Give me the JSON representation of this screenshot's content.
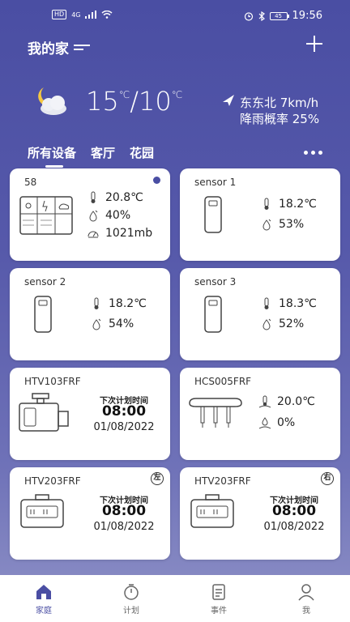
{
  "status_bar": {
    "left_box": "HD",
    "network": "4G",
    "battery": "45",
    "time": "19:56"
  },
  "header": {
    "title": "我的家"
  },
  "weather": {
    "temp_high": "15",
    "temp_low": "10",
    "unit": "℃",
    "separator": "/",
    "wind": "东东北 7km/h",
    "rain": "降雨概率 25%"
  },
  "tabs": [
    {
      "label": "所有设备",
      "active": true
    },
    {
      "label": "客厅",
      "active": false
    },
    {
      "label": "花园",
      "active": false
    }
  ],
  "devices": [
    {
      "name": "58",
      "temp": "20.8℃",
      "humidity": "40%",
      "pressure": "1021mb"
    },
    {
      "name": "sensor 1",
      "temp": "18.2℃",
      "humidity": "53%"
    },
    {
      "name": "sensor 2",
      "temp": "18.2℃",
      "humidity": "54%"
    },
    {
      "name": "sensor 3",
      "temp": "18.3℃",
      "humidity": "52%"
    },
    {
      "name": "HTV103FRF",
      "schedule_label": "下次计划时间",
      "time": "08:00",
      "date": "01/08/2022"
    },
    {
      "name": "HCS005FRF",
      "temp": "20.0℃",
      "humidity": "0%"
    },
    {
      "name": "HTV203FRF",
      "badge": "左",
      "schedule_label": "下次计划时间",
      "time": "08:00",
      "date": "01/08/2022"
    },
    {
      "name": "HTV203FRF",
      "badge": "右",
      "schedule_label": "下次计划时间",
      "time": "08:00",
      "date": "01/08/2022"
    }
  ],
  "nav": [
    {
      "label": "家庭",
      "icon": "home-icon",
      "active": true
    },
    {
      "label": "计划",
      "icon": "timer-icon",
      "active": false
    },
    {
      "label": "事件",
      "icon": "events-icon",
      "active": false
    },
    {
      "label": "我",
      "icon": "user-icon",
      "active": false
    }
  ],
  "colors": {
    "primary": "#4a4ea3",
    "card": "#ffffff",
    "text": "#222222"
  }
}
